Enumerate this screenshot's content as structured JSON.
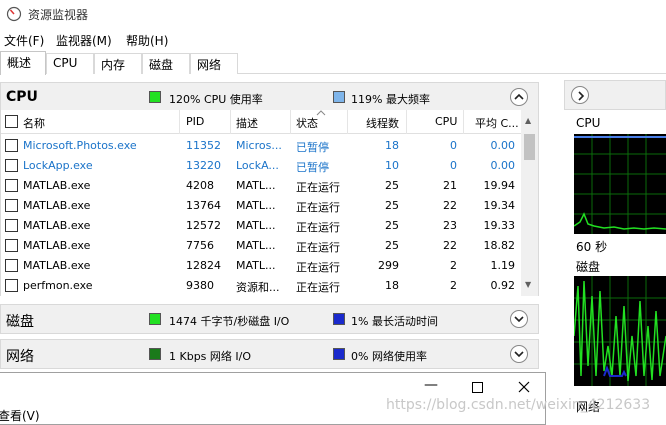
{
  "window": {
    "title": "资源监视器"
  },
  "menu": [
    "文件(F)",
    "监视器(M)",
    "帮助(H)"
  ],
  "tabs": [
    "概述",
    "CPU",
    "内存",
    "磁盘",
    "网络"
  ],
  "cpu": {
    "title": "CPU",
    "usage_text": "120% CPU 使用率",
    "freq_text": "119% 最大频率",
    "colors": {
      "usage": "#22e022",
      "freq": "#7fb5ea"
    },
    "columns": [
      "名称",
      "PID",
      "描述",
      "状态",
      "线程数",
      "CPU",
      "平均 C..."
    ],
    "rows": [
      {
        "name": "Microsoft.Photos.exe",
        "pid": "11352",
        "desc": "Micros...",
        "status": "已暂停",
        "threads": "18",
        "cpu": "0",
        "avg": "0.00",
        "suspended": true
      },
      {
        "name": "LockApp.exe",
        "pid": "13220",
        "desc": "LockA...",
        "status": "已暂停",
        "threads": "10",
        "cpu": "0",
        "avg": "0.00",
        "suspended": true
      },
      {
        "name": "MATLAB.exe",
        "pid": "4208",
        "desc": "MATL...",
        "status": "正在运行",
        "threads": "25",
        "cpu": "21",
        "avg": "19.94",
        "suspended": false
      },
      {
        "name": "MATLAB.exe",
        "pid": "13764",
        "desc": "MATL...",
        "status": "正在运行",
        "threads": "25",
        "cpu": "22",
        "avg": "19.34",
        "suspended": false
      },
      {
        "name": "MATLAB.exe",
        "pid": "12572",
        "desc": "MATL...",
        "status": "正在运行",
        "threads": "25",
        "cpu": "23",
        "avg": "19.33",
        "suspended": false
      },
      {
        "name": "MATLAB.exe",
        "pid": "7756",
        "desc": "MATL...",
        "status": "正在运行",
        "threads": "25",
        "cpu": "22",
        "avg": "18.82",
        "suspended": false
      },
      {
        "name": "MATLAB.exe",
        "pid": "12824",
        "desc": "MATL...",
        "status": "正在运行",
        "threads": "299",
        "cpu": "2",
        "avg": "1.19",
        "suspended": false
      },
      {
        "name": "perfmon.exe",
        "pid": "9380",
        "desc": "资源和...",
        "status": "正在运行",
        "threads": "18",
        "cpu": "2",
        "avg": "0.92",
        "suspended": false
      }
    ]
  },
  "disk": {
    "title": "磁盘",
    "io_text": "1474 千字节/秒磁盘 I/O",
    "active_text": "1% 最长活动时间",
    "colors": {
      "io": "#22e022",
      "active": "#1a2acc"
    }
  },
  "network": {
    "title": "网络",
    "io_text": "1 Kbps 网络 I/O",
    "usage_text": "0% 网络使用率",
    "colors": {
      "io": "#1a7a1a",
      "usage": "#1a2acc"
    }
  },
  "overlay": {
    "menu_label": "查看(V)"
  },
  "side": {
    "cpu_label": "CPU",
    "time_label": "60 秒",
    "disk_label": "磁盘",
    "net_label": "网络"
  },
  "watermark": "https://blog.csdn.net/weixin_4212633"
}
